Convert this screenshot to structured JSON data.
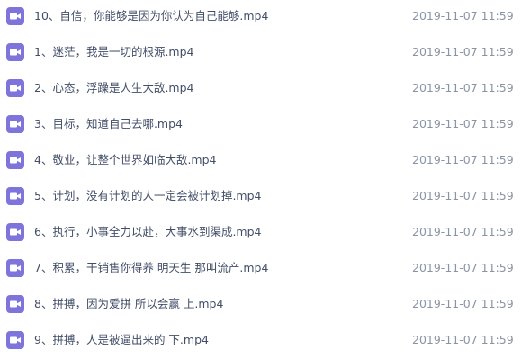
{
  "files": [
    {
      "name": "10、自信，你能够是因为你认为自己能够.mp4",
      "date": "2019-11-07 11:59",
      "icon": "video-file-icon"
    },
    {
      "name": "1、迷茫，我是一切的根源.mp4",
      "date": "2019-11-07 11:59",
      "icon": "video-file-icon"
    },
    {
      "name": "2、心态，浮躁是人生大敌.mp4",
      "date": "2019-11-07 11:59",
      "icon": "video-file-icon"
    },
    {
      "name": "3、目标，知道自己去哪.mp4",
      "date": "2019-11-07 11:59",
      "icon": "video-file-icon"
    },
    {
      "name": "4、敬业，让整个世界如临大敌.mp4",
      "date": "2019-11-07 11:59",
      "icon": "video-file-icon"
    },
    {
      "name": "5、计划，没有计划的人一定会被计划掉.mp4",
      "date": "2019-11-07 11:59",
      "icon": "video-file-icon"
    },
    {
      "name": "6、执行，小事全力以赴，大事水到渠成.mp4",
      "date": "2019-11-07 11:59",
      "icon": "video-file-icon"
    },
    {
      "name": "7、积累，干销售你得养 明天生 那叫流产.mp4",
      "date": "2019-11-07 11:59",
      "icon": "video-file-icon"
    },
    {
      "name": "8、拼搏，因为爱拼 所以会赢 上.mp4",
      "date": "2019-11-07 11:59",
      "icon": "video-file-icon"
    },
    {
      "name": "9、拼搏，人是被逼出来的 下.mp4",
      "date": "2019-11-07 11:59",
      "icon": "video-file-icon"
    }
  ],
  "colors": {
    "icon_bg": "#7f73dc",
    "name_text": "#424e67",
    "date_text": "#8b94a4"
  }
}
